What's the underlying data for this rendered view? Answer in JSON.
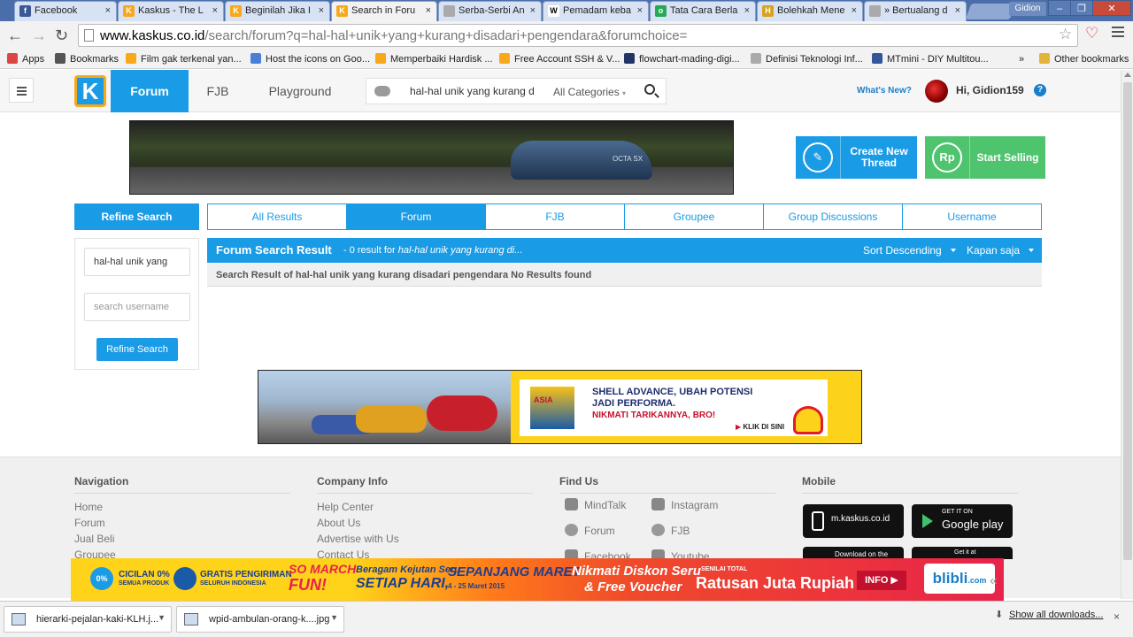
{
  "browser": {
    "tabs": [
      {
        "label": "Facebook",
        "color": "#3b5998",
        "glyph": "f"
      },
      {
        "label": "Kaskus - The L",
        "color": "#f7a81b",
        "glyph": "K"
      },
      {
        "label": "Beginilah Jika I",
        "color": "#f7a81b",
        "glyph": "K"
      },
      {
        "label": "Search in Foru",
        "color": "#f7a81b",
        "glyph": "K"
      },
      {
        "label": "Serba-Serbi An",
        "color": "#aaaaaa",
        "glyph": ""
      },
      {
        "label": "Pemadam keba",
        "color": "#ffffff",
        "glyph": "W"
      },
      {
        "label": "Tata Cara Berla",
        "color": "#22aa55",
        "glyph": "o"
      },
      {
        "label": "Bolehkah Mene",
        "color": "#d9a21a",
        "glyph": "H"
      },
      {
        "label": "» Bertualang d",
        "color": "#aaaaaa",
        "glyph": ""
      }
    ],
    "user_chip": "Gidion",
    "url_host": "www.kaskus.co.id",
    "url_path": "/search/forum?q=hal-hal+unik+yang+kurang+disadari+pengendara&forumchoice=",
    "bookmarks": [
      {
        "label": "Apps",
        "color": "#d44"
      },
      {
        "label": "Bookmarks",
        "color": "#555"
      },
      {
        "label": "Film gak terkenal yan...",
        "color": "#f7a81b"
      },
      {
        "label": "Host the icons on Goo...",
        "color": "#4a7ed9"
      },
      {
        "label": "Memperbaiki Hardisk ...",
        "color": "#f7a81b"
      },
      {
        "label": "Free Account SSH & V...",
        "color": "#f7a81b"
      },
      {
        "label": "flowchart-mading-digi...",
        "color": "#223366"
      },
      {
        "label": "Definisi Teknologi Inf...",
        "color": "#aaaaaa"
      },
      {
        "label": "MTmini - DIY Multitou...",
        "color": "#335599"
      },
      {
        "label": "»",
        "color": ""
      },
      {
        "label": "Other bookmarks",
        "color": "#e6b33a"
      }
    ]
  },
  "header": {
    "logo": "K",
    "tabs": [
      "Forum",
      "FJB",
      "Playground"
    ],
    "search_query": "hal-hal unik yang kurang d",
    "category": "All Categories",
    "whats_new": "What's New?",
    "greeting": "Hi, Gidion159",
    "help": "?"
  },
  "banner": {
    "car_text": "OCTA SX"
  },
  "cta": {
    "create": {
      "label": "Create New Thread",
      "icon": "✎",
      "color": "#1a9be6"
    },
    "sell": {
      "label": "Start Selling",
      "icon": "Rp",
      "color": "#4fc46e"
    }
  },
  "refine": {
    "title": "Refine Search",
    "query_value": "hal-hal unik yang",
    "username_placeholder": "search username",
    "button": "Refine Search"
  },
  "filter_tabs": [
    "All Results",
    "Forum",
    "FJB",
    "Groupee",
    "Group Discussions",
    "Username"
  ],
  "results": {
    "title": "Forum Search Result",
    "summary_prefix": "- 0 result for ",
    "summary_query": "hal-hal unik yang kurang di...",
    "sort": "Sort Descending",
    "time": "Kapan saja",
    "message": "Search Result of hal-hal unik yang kurang disadari pengendara No Results found"
  },
  "shell_ad": {
    "line1": "SHELL ADVANCE, UBAH POTENSI",
    "line2": "JADI PERFORMA.",
    "line3": "NIKMATI TARIKANNYA, BRO!",
    "cta": "KLIK DI SINI",
    "badge": "ASIA"
  },
  "footer": {
    "navigation": {
      "title": "Navigation",
      "links": [
        "Home",
        "Forum",
        "Jual Beli",
        "Groupee"
      ]
    },
    "company": {
      "title": "Company Info",
      "links": [
        "Help Center",
        "About Us",
        "Advertise with Us",
        "Contact Us"
      ]
    },
    "find_us": {
      "title": "Find Us",
      "items": [
        "MindTalk",
        "Instagram",
        "Forum",
        "FJB",
        "Facebook",
        "Youtube"
      ]
    },
    "mobile": {
      "title": "Mobile",
      "mkaskus": "m.kaskus.co.id",
      "googleplay_small": "GET IT ON",
      "googleplay": "Google play",
      "appstore_small": "Download on the",
      "getit": "Get it at"
    }
  },
  "blibli_ad": {
    "badge1": "0%",
    "t1a": "CICILAN 0%",
    "t1b": "SEMUA PRODUK",
    "t2a": "GRATIS PENGIRIMAN",
    "t2b": "SELURUH INDONESIA",
    "t3a": "SO MARCH",
    "t3b": "FUN!",
    "t4a": "Beragam Kejutan Seru",
    "t4b": "SETIAP HARI,",
    "t5a": "SEPANJANG MARET",
    "t5b": "4 - 25 Maret 2015",
    "t6a": "Nikmati Diskon Seru",
    "t6b": "& Free Voucher",
    "t7a": "SENILAI TOTAL",
    "t7b": "Ratusan Juta Rupiah",
    "info": "INFO",
    "brand": "blibli",
    "brand_suffix": ".com",
    "collapse": "«"
  },
  "downloads": {
    "items": [
      "hierarki-pejalan-kaki-KLH.j...",
      "wpid-ambulan-orang-k....jpg"
    ],
    "show_all": "Show all downloads...",
    "close": "×"
  }
}
